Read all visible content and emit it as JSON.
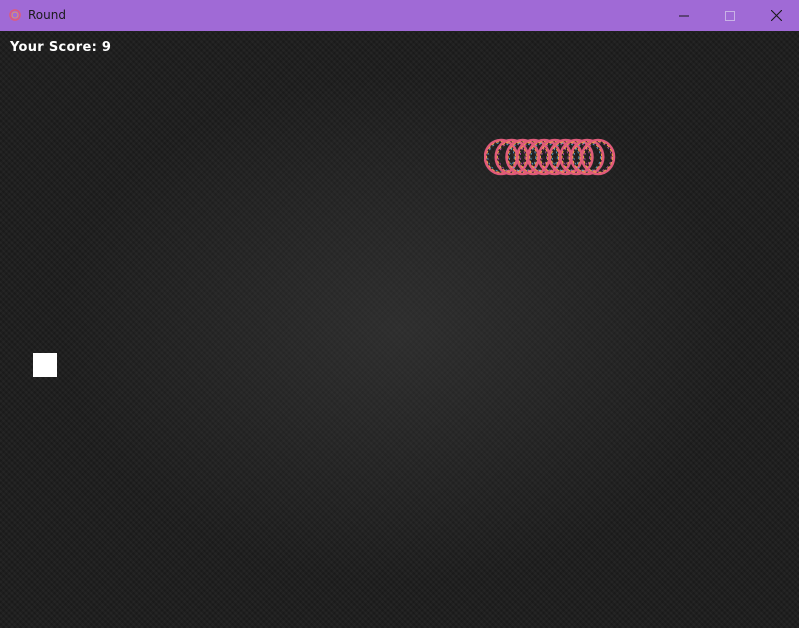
{
  "window": {
    "title": "Round",
    "title_bar_color": "#a06ad6",
    "app_icon": "ring-icon",
    "controls": {
      "minimize_icon": "minimize-icon",
      "maximize_icon": "maximize-icon",
      "close_icon": "close-icon"
    }
  },
  "game": {
    "score_text": "Your Score: 9",
    "score": 9,
    "snake_segment_count": 10,
    "snake_colors": [
      "#e05a7a",
      "#f0a04a",
      "#5aa8e0",
      "#c84ab8"
    ],
    "food_color": "#ffffff",
    "background_color": "#1c1c1c"
  }
}
